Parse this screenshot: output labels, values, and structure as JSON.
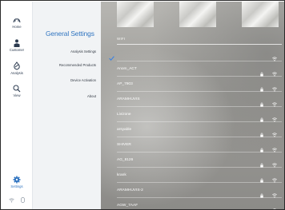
{
  "nav": {
    "items": [
      {
        "id": "home",
        "label": "Home",
        "icon": "home-icon"
      },
      {
        "id": "customer",
        "label": "Customer",
        "icon": "customer-icon"
      },
      {
        "id": "analysis",
        "label": "Analysis",
        "icon": "analysis-icon"
      },
      {
        "id": "view",
        "label": "View",
        "icon": "search-icon"
      }
    ],
    "settings": {
      "label": "Settings",
      "icon": "gear-icon",
      "active": true
    }
  },
  "settings_menu": {
    "title": "General Settings",
    "items": [
      "Analysis Settings",
      "Recommended Products",
      "Device Activation",
      "About"
    ]
  },
  "wifi": {
    "header": "WIFI",
    "networks": [
      {
        "name": "",
        "selected": true,
        "locked": false
      },
      {
        "name": "Anom_ACT",
        "selected": false,
        "locked": true
      },
      {
        "name": "AP_7903",
        "selected": false,
        "locked": true
      },
      {
        "name": "ARAMHUVIS",
        "selected": false,
        "locked": true
      },
      {
        "name": "Livizone",
        "selected": false,
        "locked": true
      },
      {
        "name": "arsyable",
        "selected": false,
        "locked": true
      },
      {
        "name": "SHIVER",
        "selected": false,
        "locked": true
      },
      {
        "name": "AG_8126",
        "selected": false,
        "locked": true
      },
      {
        "name": "krank",
        "selected": false,
        "locked": true
      },
      {
        "name": "ARAMHUVIS-2",
        "selected": false,
        "locked": true
      },
      {
        "name": "AGW_7AAF",
        "selected": false,
        "locked": false
      }
    ]
  },
  "colors": {
    "accent": "#2f74c0",
    "selected_text": "#3d83e0",
    "rail_bg": "#ffffff",
    "menu_bg": "#f1f3f5"
  }
}
